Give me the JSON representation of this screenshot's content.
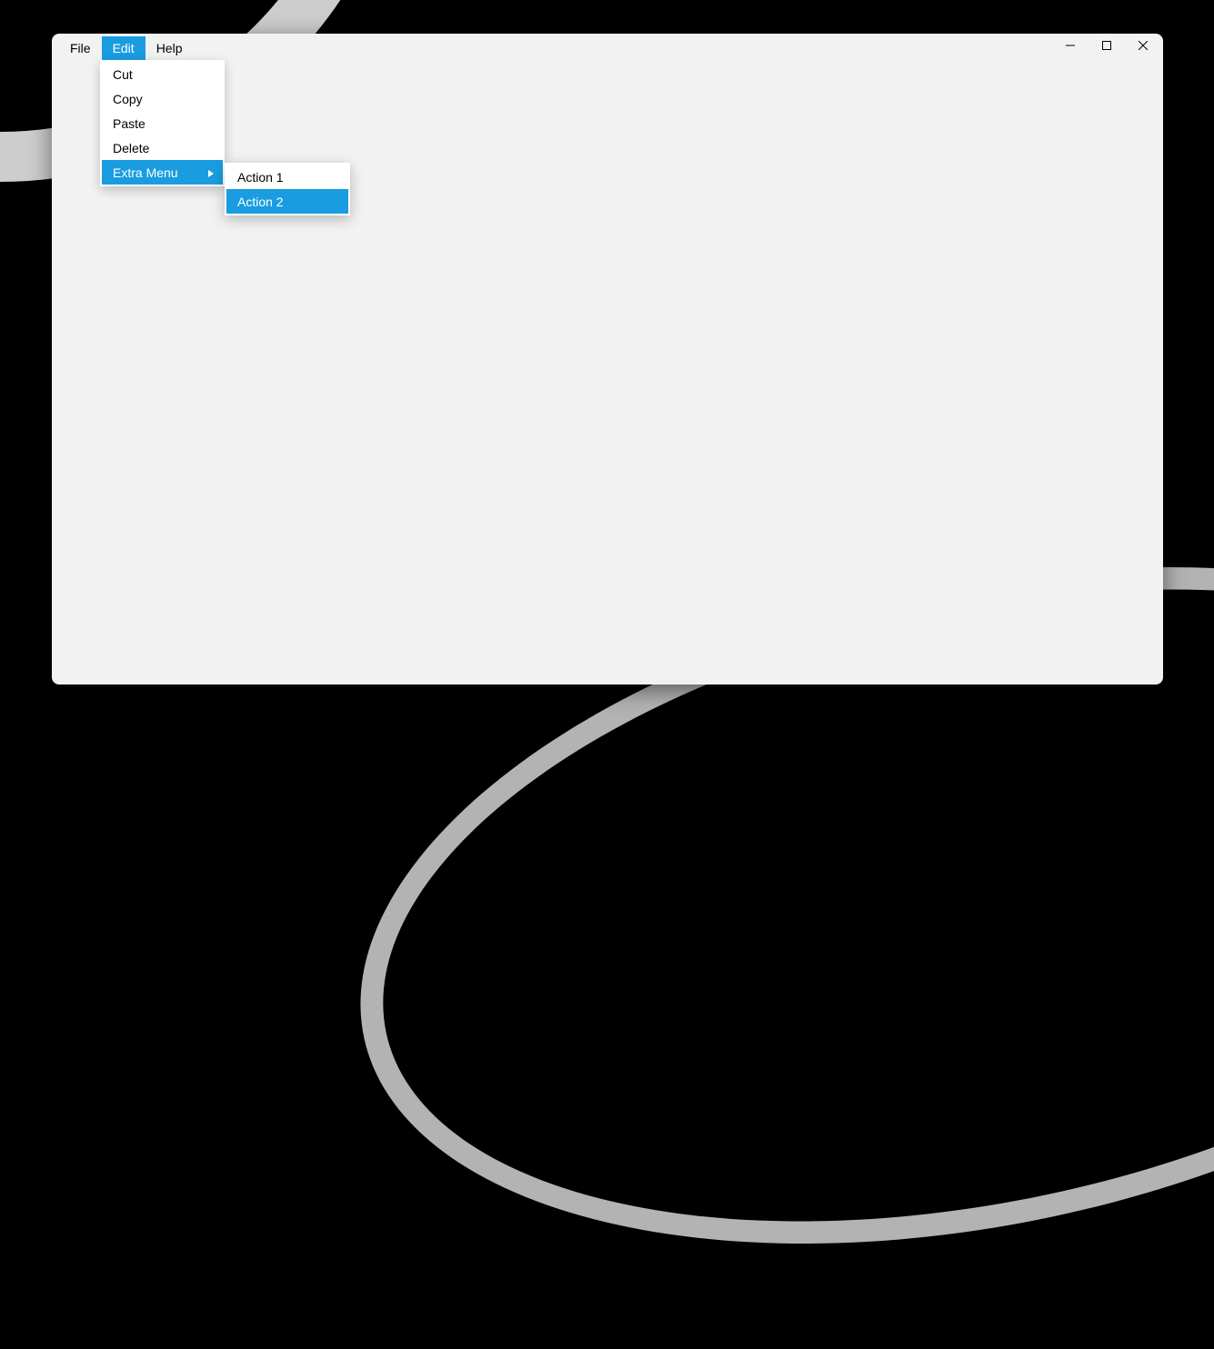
{
  "menubar": {
    "items": [
      {
        "label": "File"
      },
      {
        "label": "Edit"
      },
      {
        "label": "Help"
      }
    ]
  },
  "edit_menu": {
    "items": [
      {
        "label": "Cut"
      },
      {
        "label": "Copy"
      },
      {
        "label": "Paste"
      },
      {
        "label": "Delete"
      },
      {
        "label": "Extra Menu"
      }
    ]
  },
  "extra_submenu": {
    "items": [
      {
        "label": "Action 1"
      },
      {
        "label": "Action 2"
      }
    ]
  },
  "colors": {
    "highlight": "#199de0"
  }
}
